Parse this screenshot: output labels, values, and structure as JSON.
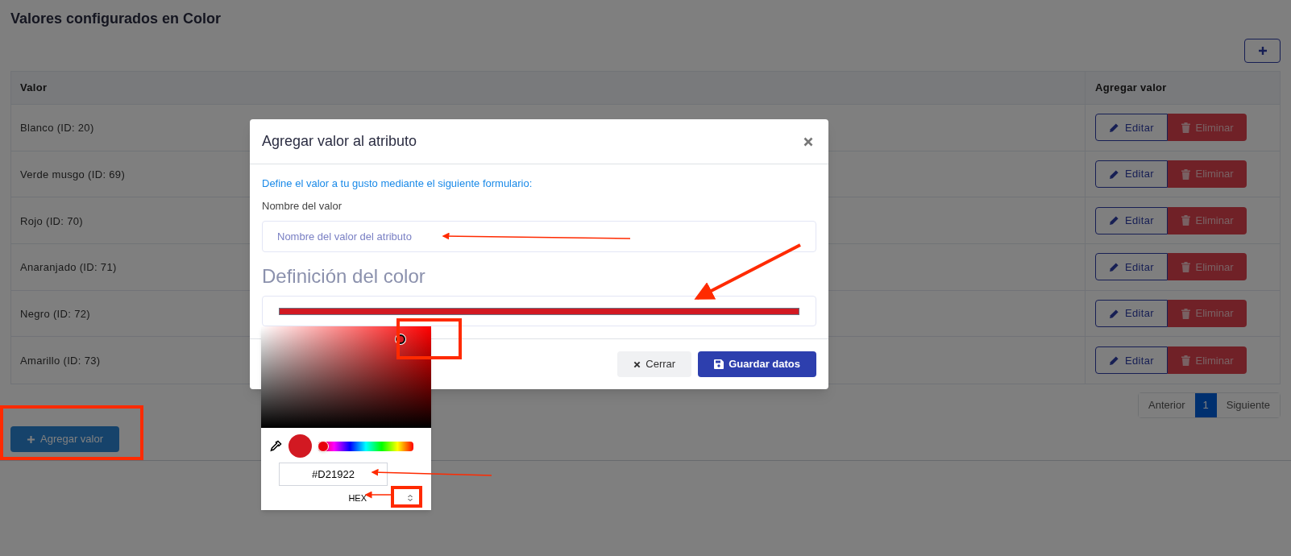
{
  "page_title": "Valores configurados en Color",
  "table": {
    "columns": [
      "Valor",
      "Agregar valor"
    ],
    "rows": [
      {
        "value": "Blanco (ID: 20)",
        "edit": "Editar",
        "delete": "Eliminar"
      },
      {
        "value": "Verde musgo (ID: 69)",
        "edit": "Editar",
        "delete": "Eliminar"
      },
      {
        "value": "Rojo (ID: 70)",
        "edit": "Editar",
        "delete": "Eliminar"
      },
      {
        "value": "Anaranjado (ID: 71)",
        "edit": "Editar",
        "delete": "Eliminar"
      },
      {
        "value": "Negro (ID: 72)",
        "edit": "Editar",
        "delete": "Eliminar"
      },
      {
        "value": "Amarillo (ID: 73)",
        "edit": "Editar",
        "delete": "Eliminar"
      }
    ]
  },
  "pagination": [
    {
      "label": "Anterior",
      "selected": false
    },
    {
      "label": "1",
      "selected": true
    },
    {
      "label": "Siguiente",
      "selected": false
    }
  ],
  "add_button": "Agregar valor",
  "modal": {
    "title": "Agregar valor al atributo",
    "intro": "Define el valor a tu gusto mediante el siguiente formulario:",
    "field_label": "Nombre del valor",
    "placeholder": "Nombre del valor del atributo",
    "section_heading": "Definición del color",
    "buttons": [
      "Cerrar",
      "Guardar datos"
    ]
  },
  "color_picker": {
    "hex_value": "#D21922",
    "mode": "HEX",
    "hue": {
      "level": 0
    }
  }
}
